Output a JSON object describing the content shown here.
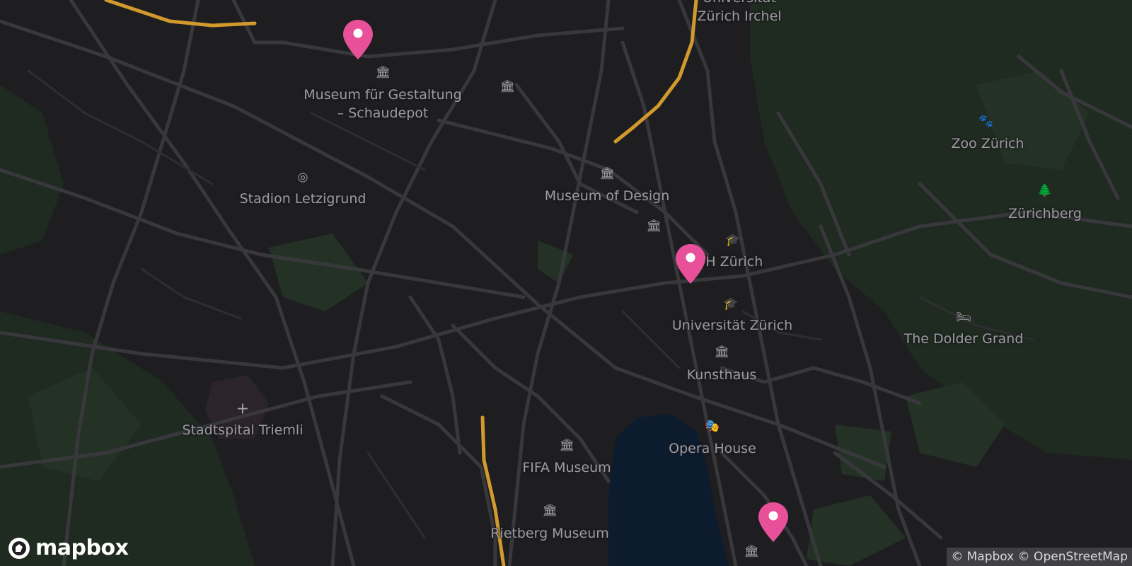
{
  "map": {
    "city": "Zürich",
    "theme": "dark",
    "colors": {
      "background": "#1e1e21",
      "road": "#3a3a3e",
      "highway": "#d29a2c",
      "park": "#233024",
      "water": "#0d1b2e",
      "marker": "#e9509a"
    }
  },
  "labels": [
    {
      "id": "uni-irchel",
      "text": "Universität\nZürich Irchel",
      "icon": ""
    },
    {
      "id": "museum-gestaltung",
      "text": "Museum für Gestaltung\n– Schaudepot",
      "icon": "museum-icon"
    },
    {
      "id": "stadion",
      "text": "Stadion Letzigrund",
      "icon": "stadium-icon"
    },
    {
      "id": "museum-design",
      "text": "Museum of Design",
      "icon": "museum-icon"
    },
    {
      "id": "eth",
      "text": "ETH Zürich",
      "icon": "university-icon"
    },
    {
      "id": "uzh",
      "text": "Universität Zürich",
      "icon": "university-icon"
    },
    {
      "id": "kunsthaus",
      "text": "Kunsthaus",
      "icon": "museum-icon"
    },
    {
      "id": "opera",
      "text": "Opera House",
      "icon": "theatre-icon"
    },
    {
      "id": "fifa",
      "text": "FIFA Museum",
      "icon": "museum-icon"
    },
    {
      "id": "rietberg",
      "text": "Rietberg Museum",
      "icon": "museum-icon"
    },
    {
      "id": "triemli",
      "text": "Stadtspital Triemli",
      "icon": "hospital-icon"
    },
    {
      "id": "zoo",
      "text": "Zoo Zürich",
      "icon": "zoo-icon"
    },
    {
      "id": "zurichberg",
      "text": "Zürichberg",
      "icon": "park-icon"
    },
    {
      "id": "dolder",
      "text": "The Dolder Grand",
      "icon": "hotel-icon"
    }
  ],
  "markers": [
    {
      "id": "marker-1",
      "name": "map-marker-northwest"
    },
    {
      "id": "marker-2",
      "name": "map-marker-center"
    },
    {
      "id": "marker-3",
      "name": "map-marker-southeast"
    }
  ],
  "logo": {
    "text": "mapbox"
  },
  "attribution": {
    "mapbox": "© Mapbox",
    "osm": "© OpenStreetMap"
  }
}
